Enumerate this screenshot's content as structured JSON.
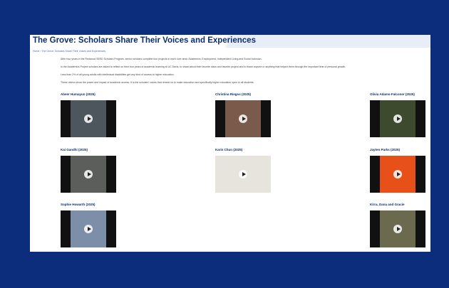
{
  "page": {
    "title": "The Grove: Scholars Share Their Voices and Experiences",
    "breadcrumb": {
      "home": "Home",
      "separator": " › ",
      "current": "The Grove: Scholars Share Their Voices and Experiences"
    },
    "intro": [
      "After four years in the Redwood SEED Scholars Program, senior scholars complete four projects in each core area: Academics, Employment, Independent Living and Social Inclusion.",
      "In the Academics Project scholars are asked to reflect on their four years of academic learning at UC Davis, to share about their favorite class and favorite project and to thank anyone or anything that helped them through the important time of personal growth.",
      "Less than 2% of all young adults with intellectual disabilities get any kind of access to higher education.",
      "These videos show the power and impact of academic access. It is the scholars' voices that remind us to make education and specifically higher education open to all students."
    ]
  },
  "videos": [
    {
      "name": "Abeer Humayun (2025)",
      "thumb_color": "#4d565c"
    },
    {
      "name": "Christina Riegos (2025)",
      "thumb_color": "#7a5a4a"
    },
    {
      "name": "Olivia Adams-Falconer (2025)",
      "thumb_color": "#3e4a2e"
    },
    {
      "name": "Kai Gandhi (2025)",
      "thumb_color": "#5b5e5a"
    },
    {
      "name": "Karis Chun (2025)",
      "thumb_color": "#e7e3dd"
    },
    {
      "name": "Jayten Parks (2025)",
      "thumb_color": "#e8501a"
    },
    {
      "name": "Sophie Howarth (2025)",
      "thumb_color": "#7d8fa8"
    },
    {
      "name": "Kirra, Dana and Gracie",
      "thumb_color": "#6b6a4e"
    }
  ]
}
